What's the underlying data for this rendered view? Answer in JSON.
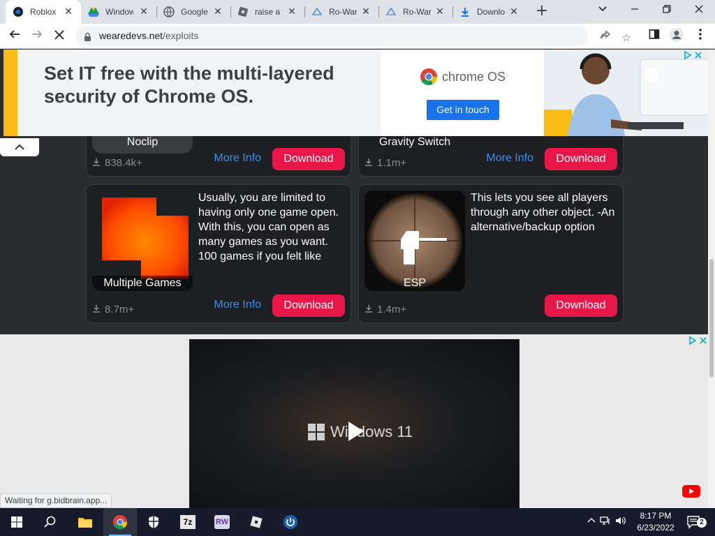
{
  "browser": {
    "tabs": [
      {
        "title": "Roblox",
        "icon": "roblox-icon",
        "active": true
      },
      {
        "title": "Windows",
        "icon": "google-drive-icon",
        "active": false
      },
      {
        "title": "Google",
        "icon": "globe-icon",
        "active": false
      },
      {
        "title": "raise a fl",
        "icon": "roblox-icon",
        "active": false
      },
      {
        "title": "Ro-War",
        "icon": "rowar-icon",
        "active": false
      },
      {
        "title": "Ro-War",
        "icon": "rowar-icon",
        "active": false
      },
      {
        "title": "Download",
        "icon": "download-icon",
        "active": false
      }
    ],
    "new_tab": "+",
    "url_host": "wearedevs.net",
    "url_path": "/exploits"
  },
  "ad_top": {
    "headline": "Set IT free with the multi-layered security of Chrome OS.",
    "brand": "chrome OS",
    "cta": "Get in touch"
  },
  "cards": [
    {
      "title": "Noclip",
      "desc": "",
      "downloads": "838.4k+",
      "more_info": "More Info",
      "download": "Download"
    },
    {
      "title": "Gravity Switch",
      "desc": "",
      "downloads": "1.1m+",
      "more_info": "More Info",
      "download": "Download"
    },
    {
      "title": "Multiple Games",
      "desc": "Usually, you are limited to having only one game open. With this, you can open as many games as you want. 100 games if you felt like",
      "downloads": "8.7m+",
      "more_info": "More Info",
      "download": "Download"
    },
    {
      "title": "ESP",
      "desc": "This lets you see all players through any other object. -An alternative/backup option",
      "downloads": "1.4m+",
      "more_info": "",
      "download": "Download"
    }
  ],
  "video_ad": {
    "brand": "Windows 11"
  },
  "status": "Waiting for g.bidbrain.app...",
  "taskbar": {
    "time": "8:17 PM",
    "date": "6/23/2022",
    "notification_count": "2",
    "app_7z_label": "7z",
    "app_rw_label": "RW"
  },
  "colors": {
    "accent_download": "#e9164a",
    "link_blue": "#3b8eea",
    "card_bg": "#1e1f22",
    "page_bg": "#2b2c2f"
  }
}
